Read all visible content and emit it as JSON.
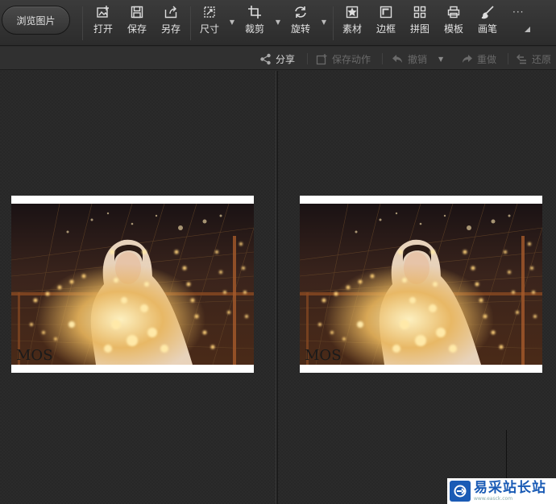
{
  "toolbar": {
    "browse_label": "浏览图片",
    "tools": [
      {
        "key": "open",
        "label": "打开"
      },
      {
        "key": "save",
        "label": "保存"
      },
      {
        "key": "save_as",
        "label": "另存"
      },
      {
        "key": "size",
        "label": "尺寸"
      },
      {
        "key": "crop",
        "label": "裁剪"
      },
      {
        "key": "rotate",
        "label": "旋转"
      },
      {
        "key": "material",
        "label": "素材"
      },
      {
        "key": "border",
        "label": "边框"
      },
      {
        "key": "collage",
        "label": "拼图"
      },
      {
        "key": "template",
        "label": "模板"
      },
      {
        "key": "brush",
        "label": "画笔"
      }
    ],
    "more": "···"
  },
  "actions": {
    "share": "分享",
    "save_action": "保存动作",
    "undo": "撤销",
    "redo": "重做",
    "restore": "还原"
  },
  "images": {
    "left_signature": "MOS",
    "right_signature": "MOS"
  },
  "watermark": {
    "name": "易采站长站",
    "url": "www.easck.com"
  },
  "colors": {
    "toolbar_bg": "#333333",
    "canvas_bg": "#272727",
    "watermark_blue": "#1a5bb5"
  }
}
